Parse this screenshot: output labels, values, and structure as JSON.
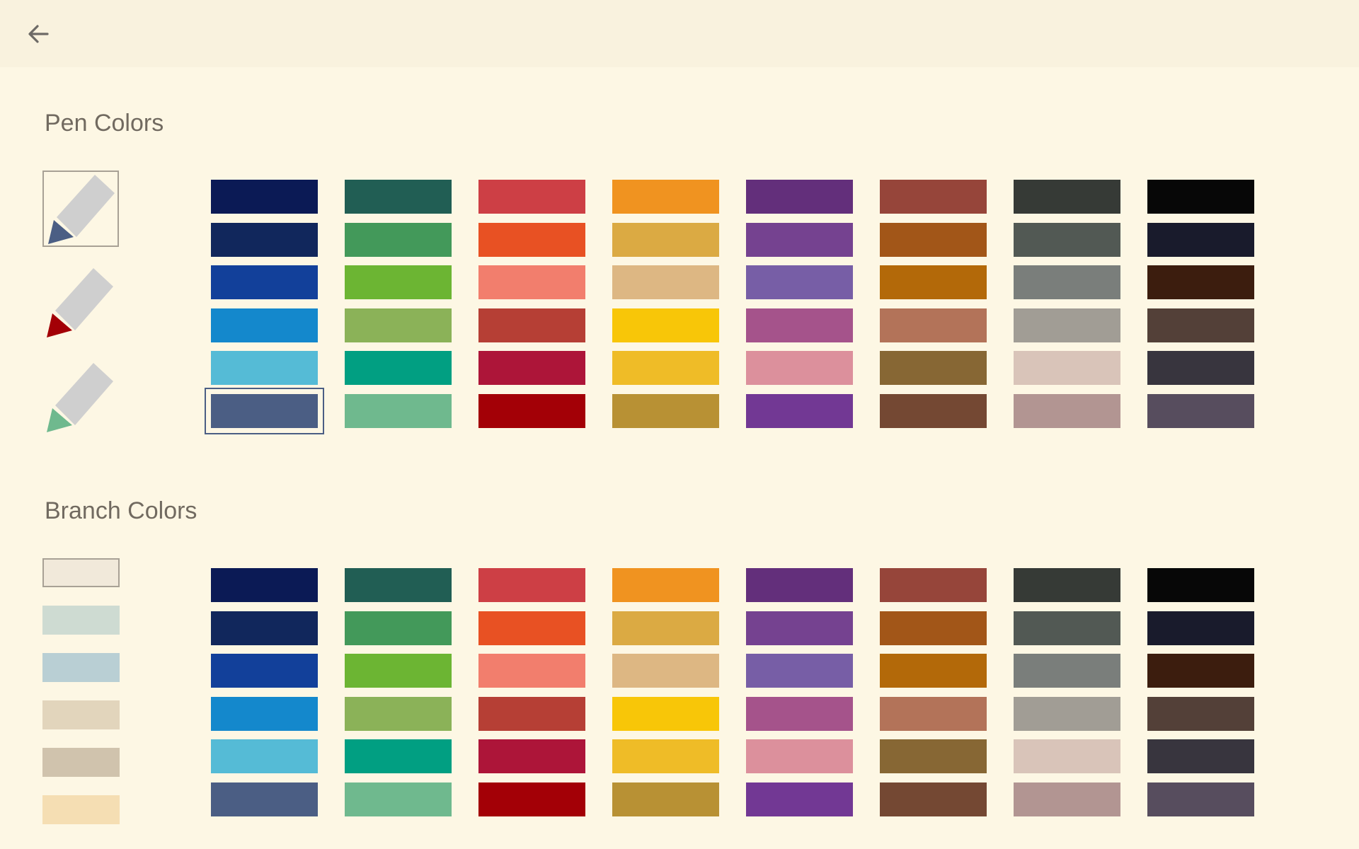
{
  "header": {
    "back_icon": "arrow-left-icon"
  },
  "pen_section": {
    "title": "Pen Colors"
  },
  "branch_section": {
    "title": "Branch Colors"
  },
  "pens": [
    {
      "tip_color": "#4b5e84",
      "body_color": "#cfcfcf",
      "selected": true
    },
    {
      "tip_color": "#a30006",
      "body_color": "#cfcfcf",
      "selected": false
    },
    {
      "tip_color": "#6fb98e",
      "body_color": "#cfcfcf",
      "selected": false
    }
  ],
  "branch_swatches": [
    {
      "color": "#f1e9da",
      "selected": true
    },
    {
      "color": "#cedbd2",
      "selected": false
    },
    {
      "color": "#b9cfd4",
      "selected": false
    },
    {
      "color": "#e2d5bc",
      "selected": false
    },
    {
      "color": "#d0c3ad",
      "selected": false
    },
    {
      "color": "#f5deb3",
      "selected": false
    }
  ],
  "palette": [
    [
      "#0b1a55",
      "#215e54",
      "#cd3f45",
      "#f09320",
      "#632f7b",
      "#96453a",
      "#363a36",
      "#070707"
    ],
    [
      "#11275c",
      "#43995a",
      "#e85123",
      "#dbaa43",
      "#754290",
      "#a25618",
      "#525954",
      "#191b2c"
    ],
    [
      "#12409a",
      "#6cb533",
      "#f27e6d",
      "#ddb783",
      "#775ea6",
      "#b36909",
      "#7a7e7b",
      "#3c1d0e"
    ],
    [
      "#1488cc",
      "#8bb258",
      "#b63f35",
      "#f8c608",
      "#a5538b",
      "#b37359",
      "#a19d95",
      "#534038"
    ],
    [
      "#55bbd6",
      "#019f82",
      "#ad1539",
      "#efbc27",
      "#dc909c",
      "#876734",
      "#d9c4b9",
      "#38353e"
    ],
    [
      "#4b5e84",
      "#6fb98e",
      "#a30006",
      "#b89134",
      "#723894",
      "#744833",
      "#b29592",
      "#574d5e"
    ]
  ],
  "pen_palette_selected": {
    "row": 5,
    "col": 0
  }
}
